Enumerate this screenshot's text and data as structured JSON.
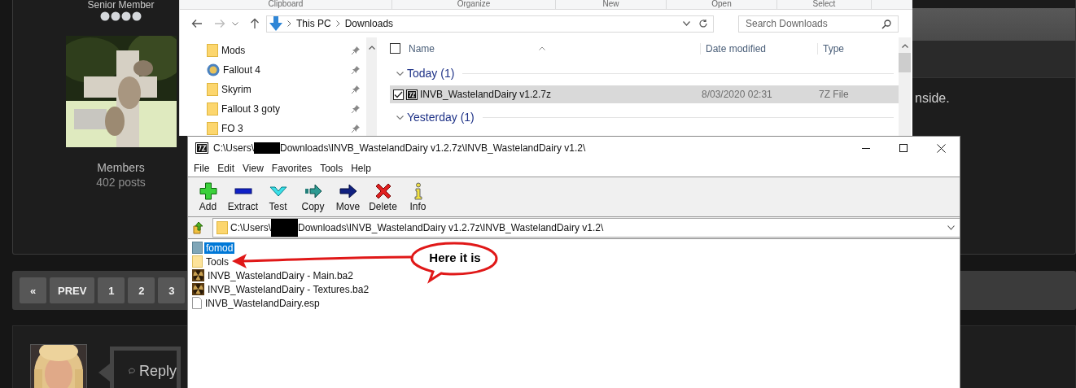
{
  "forum": {
    "profile": {
      "rank_title": "Senior Member",
      "group": "Members",
      "posts": "402 posts"
    },
    "post_text": "nside.",
    "pagination": [
      {
        "label": "«"
      },
      {
        "label": "PREV"
      },
      {
        "label": "1"
      },
      {
        "label": "2"
      },
      {
        "label": "3"
      }
    ],
    "reply_button": "Reply"
  },
  "explorer": {
    "ribbon_groups": [
      "Clipboard",
      "Organize",
      "New",
      "Open",
      "Select"
    ],
    "breadcrumb": [
      "This PC",
      "Downloads"
    ],
    "search": {
      "placeholder": "Search Downloads"
    },
    "nav_items": [
      {
        "label": "Mods",
        "kind": "folder"
      },
      {
        "label": "Fallout 4",
        "kind": "app"
      },
      {
        "label": "Skyrim",
        "kind": "folder"
      },
      {
        "label": "Fallout 3 goty",
        "kind": "folder"
      },
      {
        "label": "FO 3",
        "kind": "folder"
      }
    ],
    "select_all": {
      "checked": false
    },
    "columns": [
      "Name",
      "Date modified",
      "Type"
    ],
    "groups": [
      {
        "label": "Today (1)",
        "expanded": true,
        "rows": [
          {
            "name": "INVB_WastelandDairy v1.2.7z",
            "date": "8/03/2020 02:31",
            "type": "7Z File",
            "selected": true,
            "checked": true
          }
        ]
      },
      {
        "label": "Yesterday (1)",
        "expanded": true
      }
    ]
  },
  "archive": {
    "title_prefix": "C:\\Users\\",
    "title_suffix": "Downloads\\INVB_WastelandDairy v1.2.7z\\INVB_WastelandDairy v1.2\\",
    "menu": [
      "File",
      "Edit",
      "View",
      "Favorites",
      "Tools",
      "Help"
    ],
    "toolbar": [
      {
        "label": "Add",
        "kind": "add"
      },
      {
        "label": "Extract",
        "kind": "extract"
      },
      {
        "label": "Test",
        "kind": "test"
      },
      {
        "label": "Copy",
        "kind": "copy"
      },
      {
        "label": "Move",
        "kind": "move"
      },
      {
        "label": "Delete",
        "kind": "delete"
      },
      {
        "label": "Info",
        "kind": "info"
      }
    ],
    "path_prefix": "C:\\Users\\",
    "path_suffix": "Downloads\\INVB_WastelandDairy v1.2.7z\\INVB_WastelandDairy v1.2\\",
    "files": [
      {
        "name": "fomod",
        "kind": "folder",
        "selected": true
      },
      {
        "name": "Tools",
        "kind": "folder",
        "selected": false
      },
      {
        "name": "INVB_WastelandDairy - Main.ba2",
        "kind": "archive",
        "selected": false
      },
      {
        "name": "INVB_WastelandDairy - Textures.ba2",
        "kind": "archive",
        "selected": false
      },
      {
        "name": "INVB_WastelandDairy.esp",
        "kind": "file",
        "selected": false
      }
    ],
    "annotation": {
      "label": "Here it is"
    }
  }
}
